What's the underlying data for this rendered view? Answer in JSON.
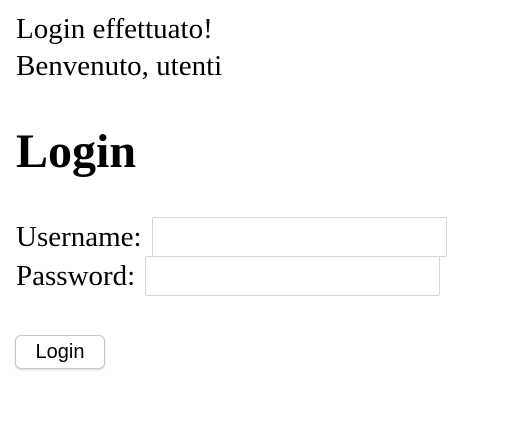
{
  "status": {
    "message": "Login effettuato!",
    "welcome": "Benvenuto, utenti"
  },
  "form": {
    "title": "Login",
    "username_label": "Username:",
    "username_value": "",
    "password_label": "Password:",
    "password_value": "",
    "submit_label": "Login"
  },
  "colors": {
    "background": "#ffffff",
    "text": "#000000",
    "input_border": "#d6d6d6"
  }
}
